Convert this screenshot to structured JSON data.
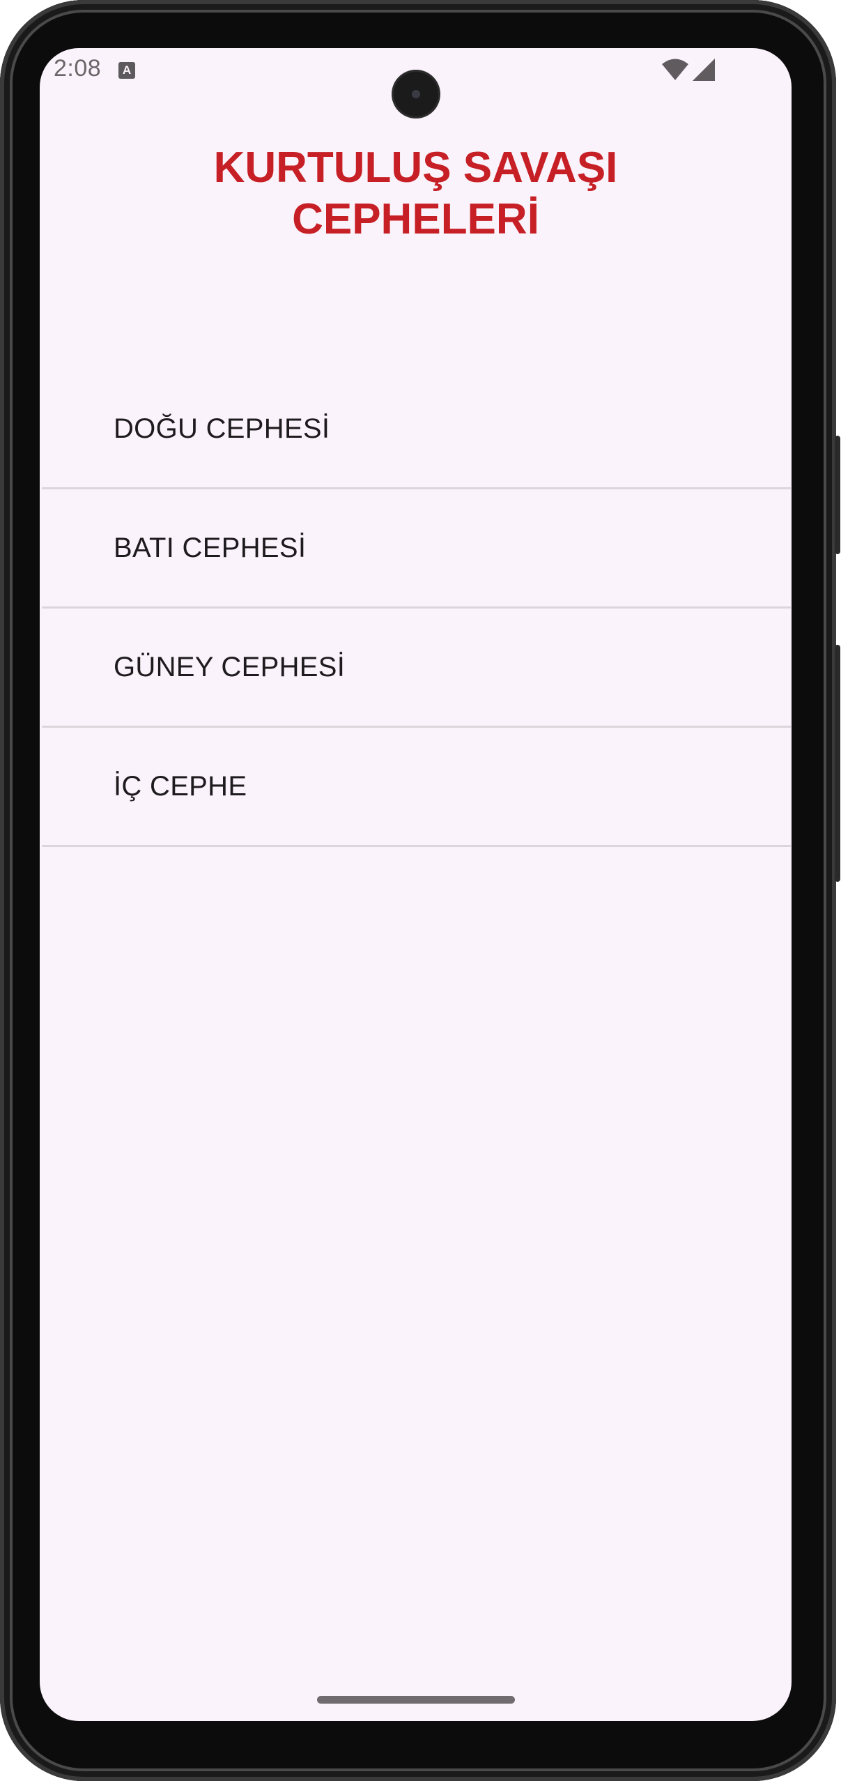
{
  "status_bar": {
    "time": "2:08",
    "notification_icon": "A",
    "wifi_icon": "wifi-icon",
    "signal_icon": "cellular-signal-icon"
  },
  "app": {
    "title_line1": "KURTULUŞ SAVAŞI",
    "title_line2": "CEPHELERİ",
    "title_color": "#c62026"
  },
  "list": {
    "items": [
      {
        "label": "DOĞU CEPHESİ"
      },
      {
        "label": "BATI CEPHESİ"
      },
      {
        "label": "GÜNEY CEPHESİ"
      },
      {
        "label": "İÇ CEPHE"
      }
    ]
  }
}
